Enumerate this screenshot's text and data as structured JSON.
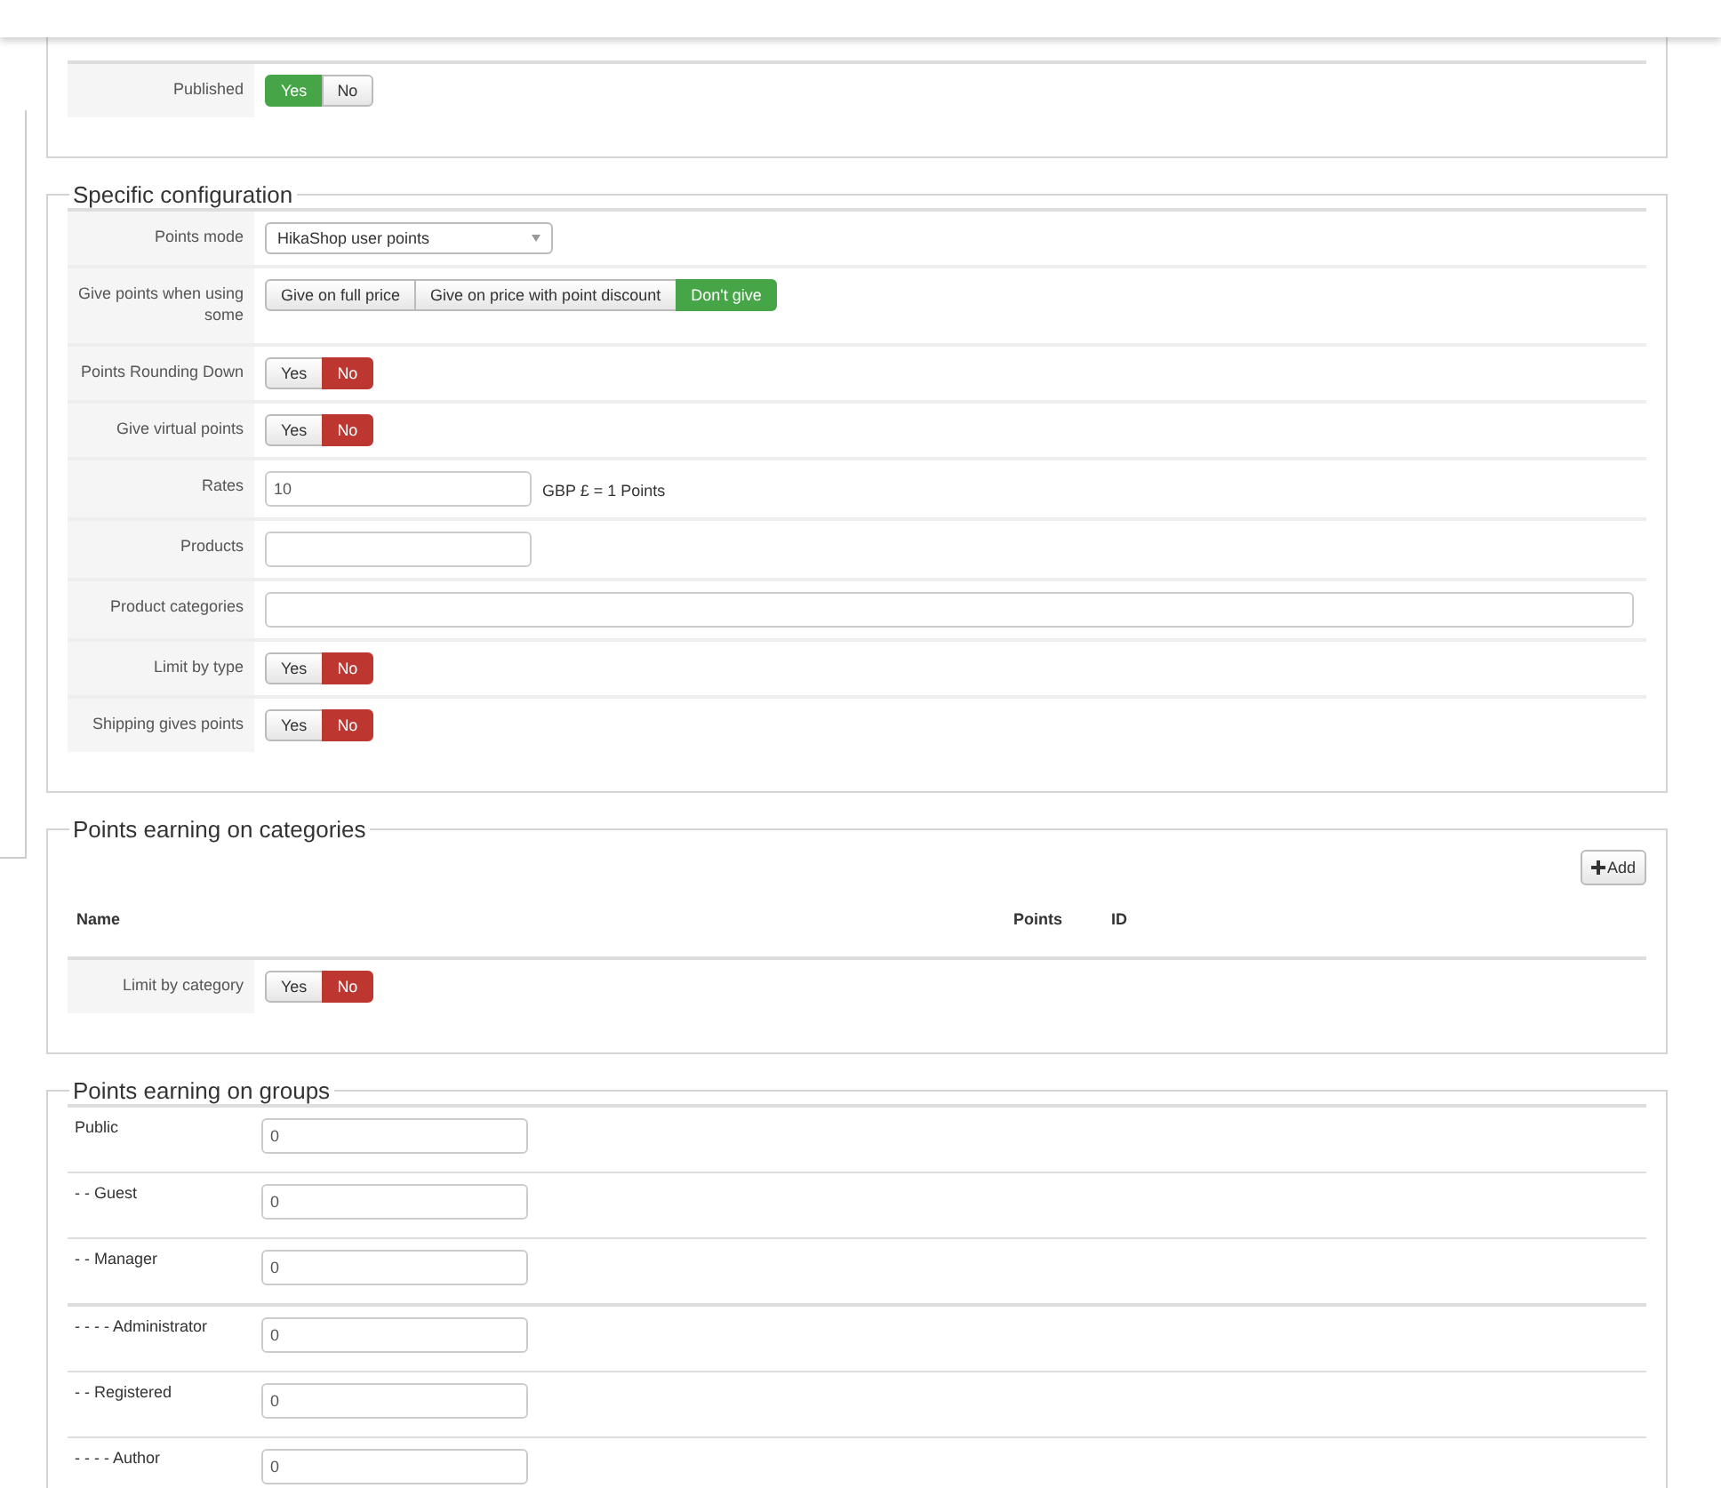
{
  "generic": {
    "rows": [
      {
        "label": "Published",
        "kind": "toggle",
        "options": [
          {
            "label": "Yes",
            "selected": true,
            "kind": "positive"
          },
          {
            "label": "No",
            "selected": false
          }
        ]
      }
    ]
  },
  "specific": {
    "legend": "Specific configuration",
    "rows": [
      {
        "label": "Points mode",
        "kind": "select",
        "value": "HikaShop user points"
      },
      {
        "label": "Give points when using some",
        "kind": "toggle",
        "options": [
          {
            "label": "Give on full price",
            "selected": false
          },
          {
            "label": "Give on price with point discount",
            "selected": false
          },
          {
            "label": "Don't give",
            "selected": true,
            "kind": "positive"
          }
        ]
      },
      {
        "label": "Points Rounding Down",
        "kind": "toggle",
        "options": [
          {
            "label": "Yes",
            "selected": false
          },
          {
            "label": "No",
            "selected": true,
            "kind": "negative"
          }
        ]
      },
      {
        "label": "Give virtual points",
        "kind": "toggle",
        "options": [
          {
            "label": "Yes",
            "selected": false
          },
          {
            "label": "No",
            "selected": true,
            "kind": "negative"
          }
        ]
      },
      {
        "label": "Rates",
        "kind": "input",
        "value": "10",
        "suffix": "GBP £ = 1 Points"
      },
      {
        "label": "Products",
        "kind": "input"
      },
      {
        "label": "Product categories",
        "kind": "wide-input"
      },
      {
        "label": "Limit by type",
        "kind": "toggle",
        "options": [
          {
            "label": "Yes",
            "selected": false
          },
          {
            "label": "No",
            "selected": true,
            "kind": "negative"
          }
        ]
      },
      {
        "label": "Shipping gives points",
        "kind": "toggle",
        "options": [
          {
            "label": "Yes",
            "selected": false
          },
          {
            "label": "No",
            "selected": true,
            "kind": "negative"
          }
        ]
      }
    ]
  },
  "categories": {
    "legend": "Points earning on categories",
    "add_button": "Add",
    "columns": [
      "Name",
      "Points",
      "ID"
    ],
    "rows": [
      {
        "label": "Limit by category",
        "kind": "toggle",
        "options": [
          {
            "label": "Yes",
            "selected": false
          },
          {
            "label": "No",
            "selected": true,
            "kind": "negative"
          }
        ]
      }
    ]
  },
  "groups": {
    "legend": "Points earning on groups",
    "rows": [
      {
        "name": "Public",
        "value": "0"
      },
      {
        "name": "- - Guest",
        "value": "0"
      },
      {
        "name": "- - Manager",
        "value": "0"
      },
      {
        "name": "- - - - Administrator",
        "value": "0"
      },
      {
        "name": "- - Registered",
        "value": "0"
      },
      {
        "name": "- - - - Author",
        "value": "0"
      }
    ]
  }
}
